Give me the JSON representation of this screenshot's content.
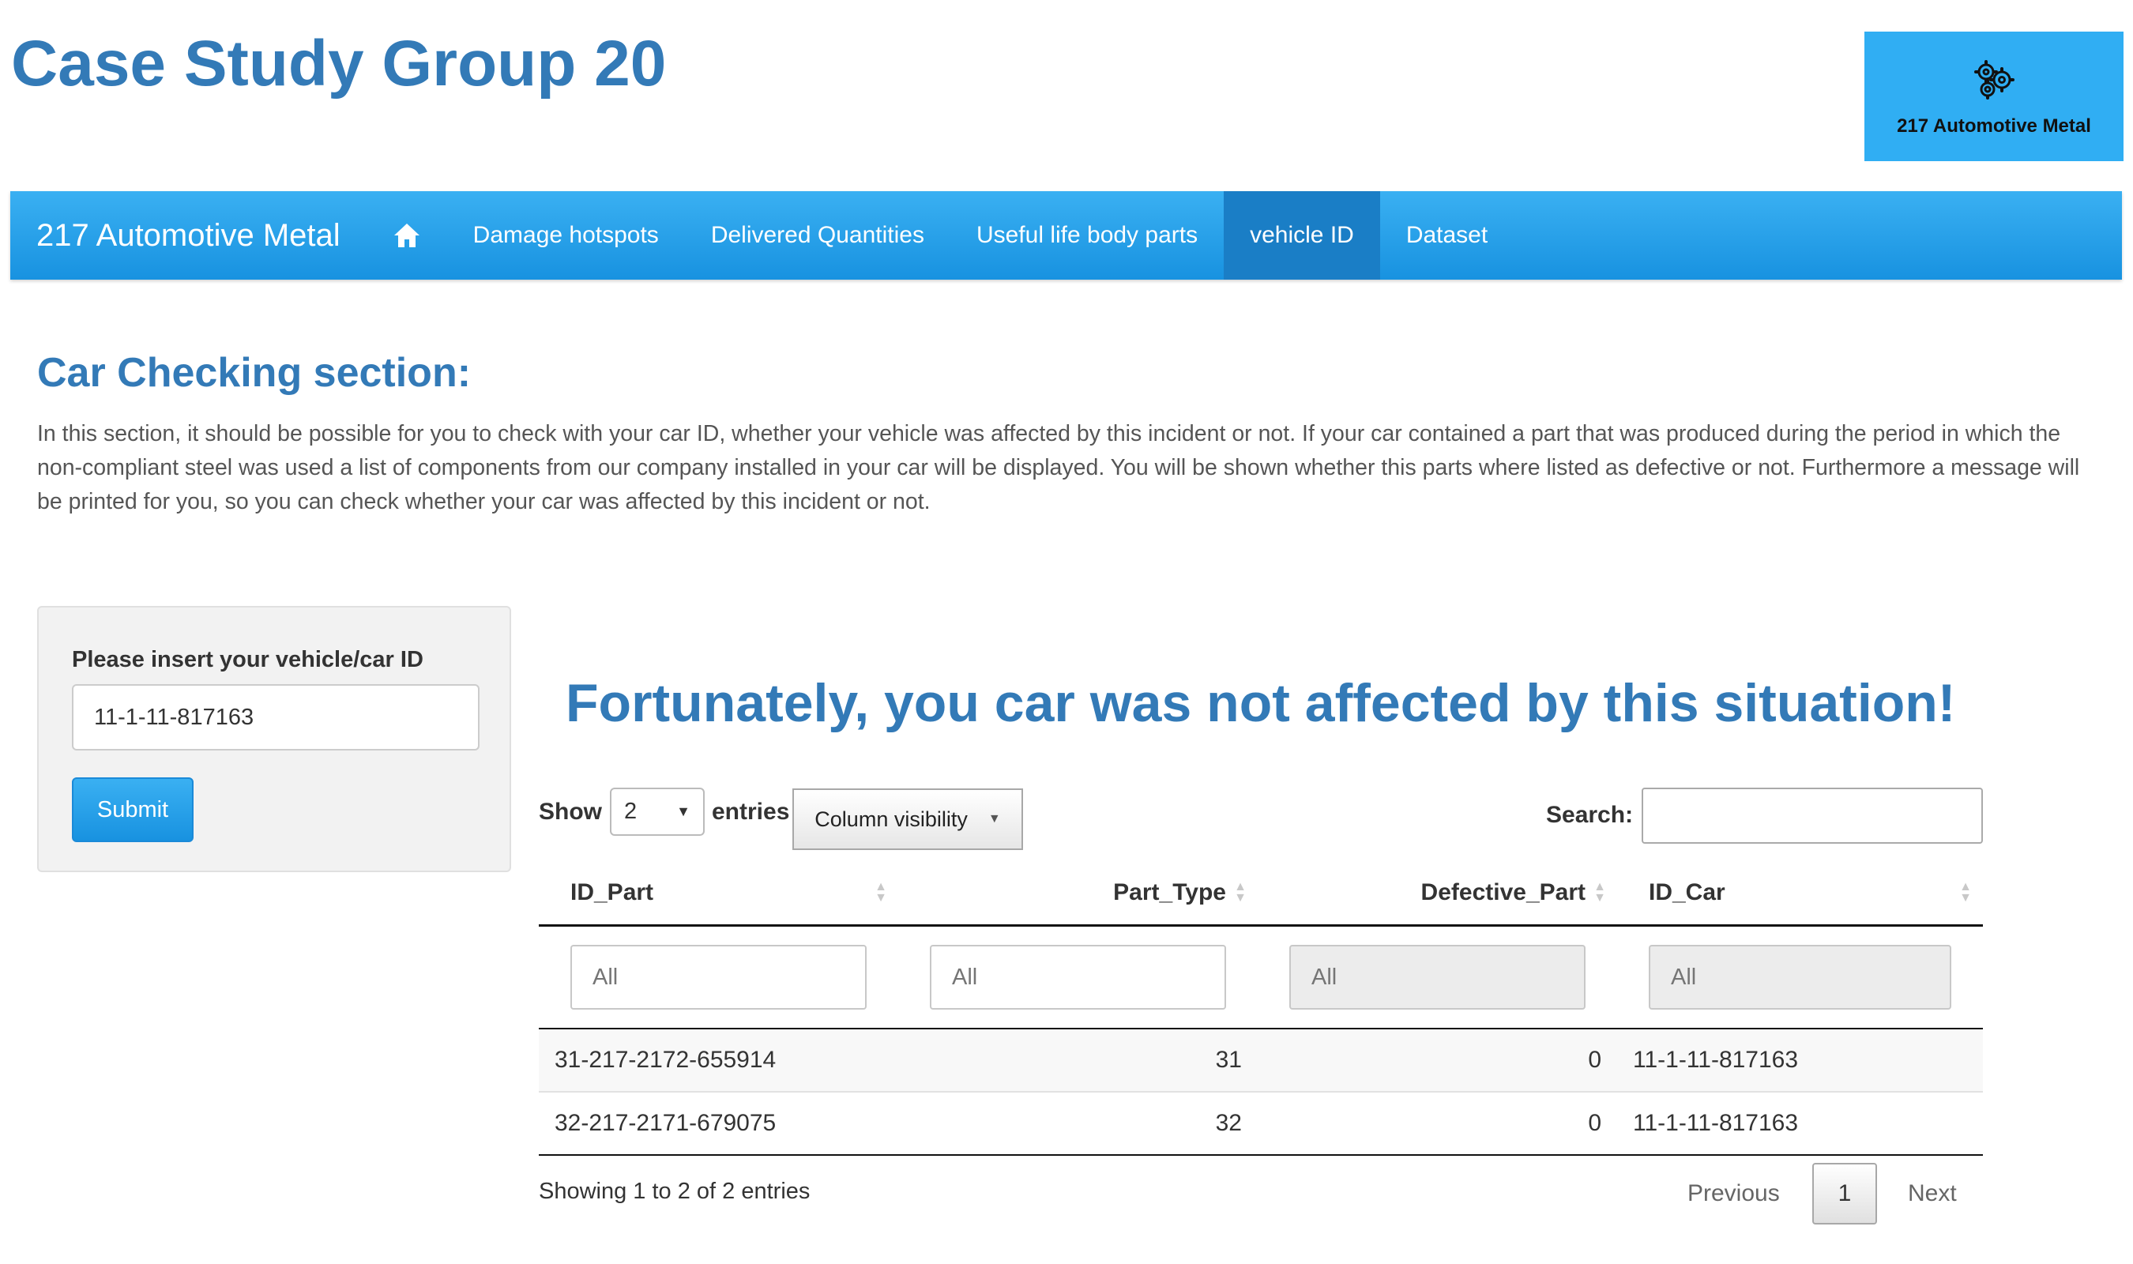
{
  "header": {
    "title": "Case Study Group 20",
    "logo_text": "217 Automotive Metal",
    "logo_icon": "gears-icon"
  },
  "navbar": {
    "brand": "217 Automotive Metal",
    "home_icon": "home-icon",
    "items": [
      {
        "label": "Damage hotspots",
        "active": false
      },
      {
        "label": "Delivered Quantities",
        "active": false
      },
      {
        "label": "Useful life body parts",
        "active": false
      },
      {
        "label": "vehicle ID",
        "active": true
      },
      {
        "label": "Dataset",
        "active": false
      }
    ],
    "colors": {
      "bar": "#2aa3ea",
      "active": "#1a7ec6",
      "heading": "#337ab7"
    }
  },
  "main": {
    "section_title": "Car Checking section:",
    "description": "In this section, it should be possible for you to check with your car ID, whether your vehicle was affected by this incident or not. If your car contained a part that was produced during the period in which the non-compliant steel was used a list of components from our company installed in your car will be displayed. You will be shown whether this parts where listed as defective or not. Furthermore a message will be printed for you, so you can check whether your car was affected by this incident or not."
  },
  "input_panel": {
    "label": "Please insert your vehicle/car ID",
    "value": "11-1-11-817163",
    "submit_label": "Submit"
  },
  "result": {
    "message": "Fortunately, you car was not affected by this situation!"
  },
  "table_controls": {
    "show_label": "Show",
    "entries_value": "2",
    "entries_label": "entries",
    "column_visibility_label": "Column visibility",
    "search_label": "Search:",
    "search_value": ""
  },
  "table": {
    "columns": [
      "ID_Part",
      "Part_Type",
      "Defective_Part",
      "ID_Car"
    ],
    "filter_placeholder": "All",
    "rows": [
      [
        "31-217-2172-655914",
        "31",
        "0",
        "11-1-11-817163"
      ],
      [
        "32-217-2171-679075",
        "32",
        "0",
        "11-1-11-817163"
      ]
    ]
  },
  "pagination": {
    "info": "Showing 1 to 2 of 2 entries",
    "previous": "Previous",
    "current_page": "1",
    "next": "Next"
  }
}
